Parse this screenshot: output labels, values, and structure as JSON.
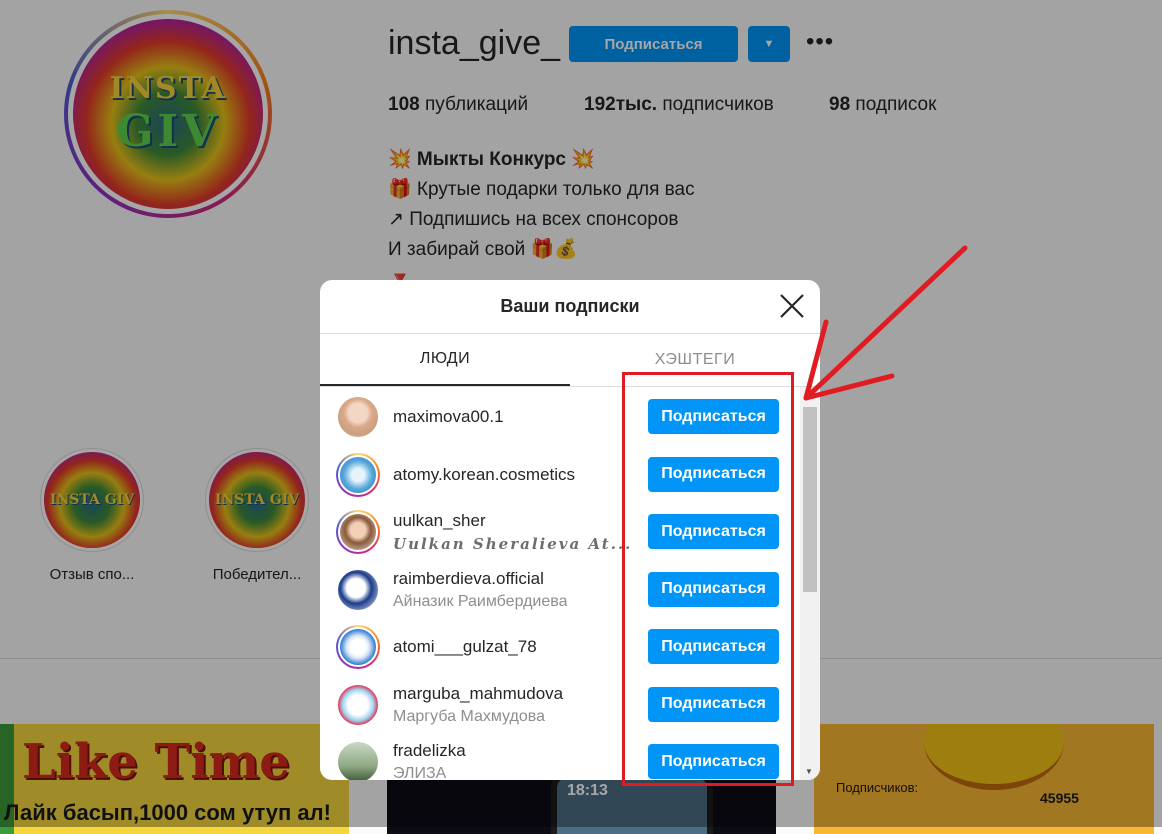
{
  "profile": {
    "avatar_text_top": "INSTA",
    "avatar_text_bottom": "GIV",
    "username": "insta_give_",
    "follow_label": "Подписаться",
    "stats": {
      "posts_count": "108",
      "posts_label": "публикаций",
      "followers_count": "192тыс.",
      "followers_label": "подписчиков",
      "following_count": "98",
      "following_label": "подписок"
    },
    "bio": {
      "line1": "💥 Мыкты Конкурс 💥",
      "line2": "🎁 Крутые подарки только для вас",
      "line3": "↗ Подпишись на всех спонсоров",
      "line4": "И забирай свой 🎁💰",
      "line5": "🔻"
    }
  },
  "highlights": [
    {
      "label": "Отзыв спо...",
      "text": "INSTA GIV"
    },
    {
      "label": "Победител...",
      "text": "INSTA GIV"
    }
  ],
  "posts": {
    "post1_big": "Like Time",
    "post1_small": "Лайк басып,1000 сом утуп ал!",
    "post2_time": "18:13",
    "post3_sub": "Подписчиков:",
    "post3_num": "45955"
  },
  "modal": {
    "title": "Ваши подписки",
    "tabs": {
      "people": "ЛЮДИ",
      "hashtags": "ХЭШТЕГИ"
    },
    "follow_label": "Подписаться",
    "users": [
      {
        "username": "maximova00.1",
        "full_name": ""
      },
      {
        "username": "atomy.korean.cosmetics",
        "full_name": ""
      },
      {
        "username": "uulkan_sher",
        "full_name": "Uulkan Sheralieva At..."
      },
      {
        "username": "raimberdieva.official",
        "full_name": "Айназик Раимбердиева"
      },
      {
        "username": "atomi___gulzat_78",
        "full_name": ""
      },
      {
        "username": "marguba_mahmudova",
        "full_name": "Маргуба Махмудова"
      },
      {
        "username": "fradelizka",
        "full_name": "ЭЛИЗА"
      }
    ]
  },
  "colors": {
    "accent": "#0095f6",
    "annotation": "#e11b22"
  }
}
